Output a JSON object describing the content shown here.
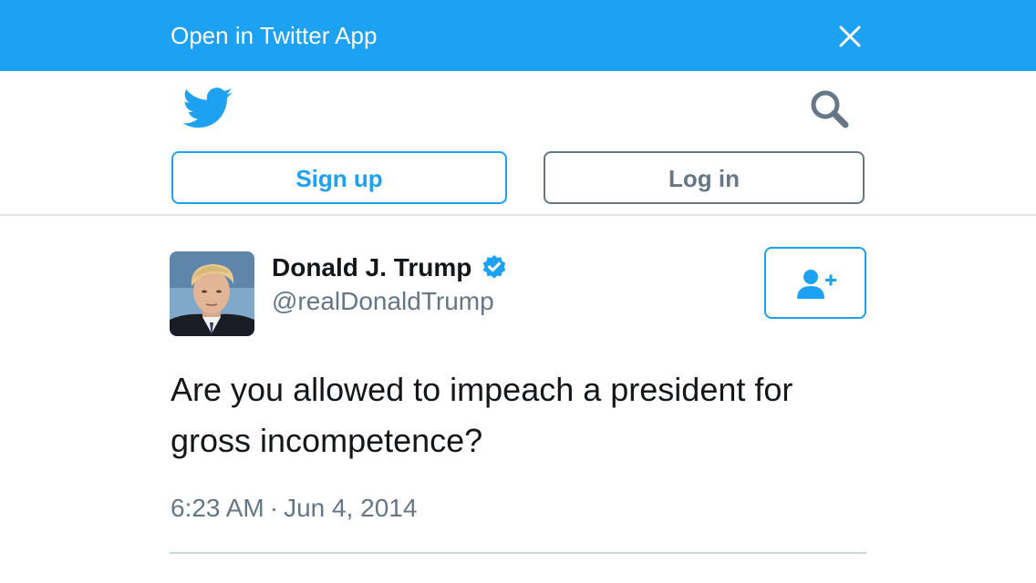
{
  "banner": {
    "text": "Open in Twitter App",
    "close_icon": "close-icon",
    "background": "#1DA1F2"
  },
  "header": {
    "logo_icon": "twitter-bird-icon",
    "search_icon": "search-icon",
    "signup_label": "Sign up",
    "login_label": "Log in"
  },
  "tweet": {
    "author_name": "Donald J. Trump",
    "author_handle": "@realDonaldTrump",
    "verified": true,
    "verified_icon": "verified-badge-icon",
    "follow_icon": "follow-user-icon",
    "text": "Are you allowed to impeach a president for gross incompetence?",
    "time": "6:23 AM",
    "date": "Jun 4, 2014"
  },
  "colors": {
    "accent": "#1DA1F2",
    "text_primary": "#14171A",
    "text_secondary": "#657786",
    "divider": "#E1E8ED"
  }
}
